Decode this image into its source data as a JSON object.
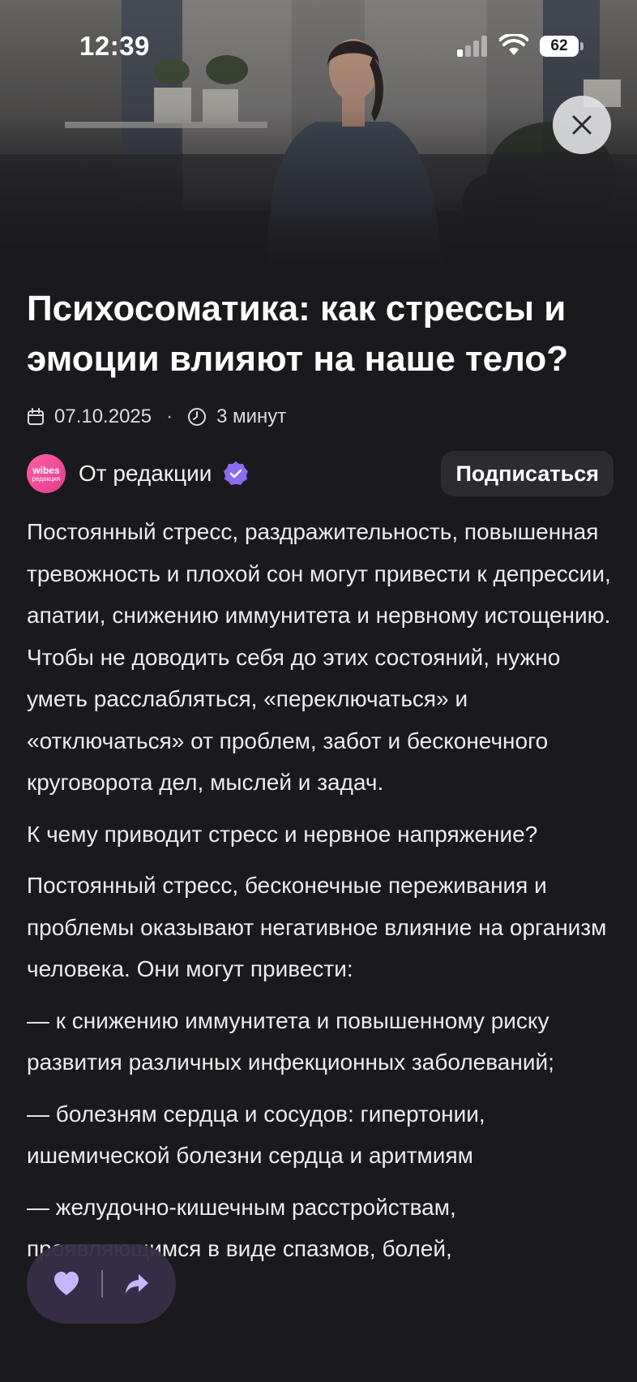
{
  "status_bar": {
    "time": "12:39",
    "battery": "62",
    "icons": [
      "signal-icon",
      "wifi-icon",
      "battery-icon"
    ]
  },
  "hero": {
    "icons": [
      "close-icon"
    ]
  },
  "article": {
    "title": "Психосоматика: как стрессы и эмоции влияют на наше тело?",
    "date": "07.10.2025",
    "separator": "·",
    "read_time": "3 минут",
    "author": {
      "avatar_line1": "wibes",
      "avatar_line2": "редакция",
      "name": "От редакции",
      "subscribe_label": "Подписаться"
    },
    "paragraphs": [
      "Постоянный стресс, раздражительность, повышенная тревожность и плохой сон могут привести к депрессии, апатии, снижению иммунитета и нервному истощению. Чтобы не доводить себя до этих состояний, нужно уметь расслабляться, «переключаться» и «отключаться» от проблем, забот и бесконечного круговорота дел, мыслей и задач.",
      "К чему приводит стресс и нервное напряжение?",
      "Постоянный стресс, бесконечные переживания и проблемы оказывают негативное влияние на организм человека. Они могут привести:",
      "— к снижению иммунитета и повышенному риску развития различных инфекционных заболеваний;",
      "— болезням сердца и сосудов: гипертонии, ишемической болезни сердца и аритмиям",
      "— желудочно-кишечным расстройствам, проявляющимся в виде спазмов, болей,"
    ]
  },
  "actions": {
    "icons": [
      "heart-icon",
      "share-icon"
    ]
  },
  "colors": {
    "background": "#1a191d",
    "accent": "#8b6cf0",
    "action_pill": "#362e48",
    "heart": "#c7b6ff"
  }
}
